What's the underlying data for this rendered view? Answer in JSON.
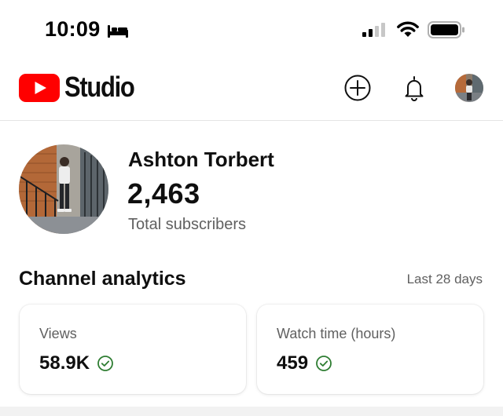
{
  "status_bar": {
    "time": "10:09",
    "icons": [
      "bed-icon",
      "cellular-signal-icon",
      "wifi-icon",
      "battery-icon"
    ]
  },
  "header": {
    "logo_text": "Studio",
    "actions": [
      "create-icon",
      "bell-icon",
      "avatar"
    ],
    "brand_color": "#ff0000"
  },
  "channel": {
    "name": "Ashton Torbert",
    "subscriber_count": "2,463",
    "subscriber_label": "Total subscribers"
  },
  "analytics": {
    "title": "Channel analytics",
    "period": "Last 28 days",
    "cards": [
      {
        "label": "Views",
        "value": "58.9K",
        "status_icon": "check-circle-icon"
      },
      {
        "label": "Watch time (hours)",
        "value": "459",
        "status_icon": "check-circle-icon"
      }
    ],
    "check_color": "#2e7d32"
  }
}
